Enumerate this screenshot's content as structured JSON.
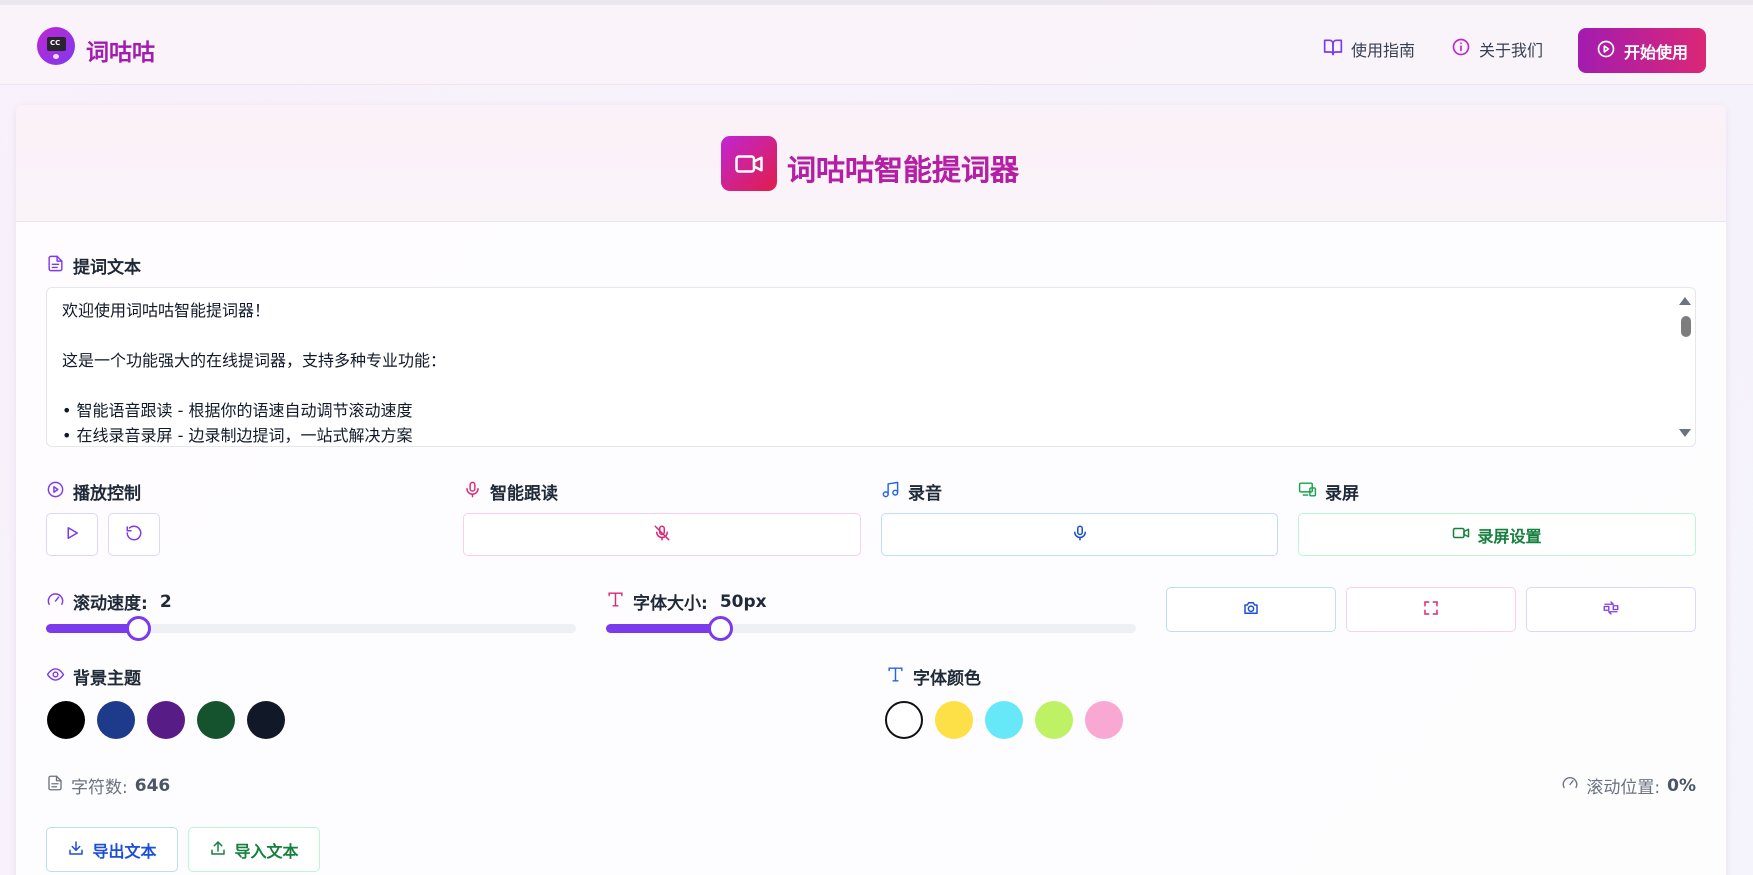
{
  "header": {
    "brand": "词咕咕",
    "nav": {
      "guide": "使用指南",
      "about": "关于我们"
    },
    "start_button": "开始使用"
  },
  "card": {
    "title": "词咕咕智能提词器"
  },
  "script_section": {
    "label": "提词文本",
    "lines": [
      "欢迎使用词咕咕智能提词器！",
      "",
      "这是一个功能强大的在线提词器，支持多种专业功能：",
      "",
      "• 智能语音跟读 - 根据你的语速自动调节滚动速度",
      "• 在线录音录屏 - 边录制边提词，一站式解决方案"
    ]
  },
  "controls": {
    "playback_label": "播放控制",
    "voice_follow_label": "智能跟读",
    "record_audio_label": "录音",
    "record_screen_label": "录屏",
    "record_settings_button": "录屏设置"
  },
  "sliders": {
    "speed_label": "滚动速度:",
    "speed_value": "2",
    "speed_fraction": 0.173,
    "font_label": "字体大小:",
    "font_value": "50px",
    "font_fraction": 0.215
  },
  "themes": {
    "bg_label": "背景主题",
    "bg_colors": [
      "#000000",
      "#1e3a8a",
      "#581c87",
      "#14532d",
      "#111827"
    ],
    "font_label": "字体颜色",
    "font_colors": [
      "#ffffff",
      "#fde047",
      "#67e8f9",
      "#bef264",
      "#f9a8d4"
    ]
  },
  "stats": {
    "chars_label": "字符数:",
    "chars_value": "646",
    "scroll_label": "滚动位置:",
    "scroll_value": "0%"
  },
  "actions": {
    "export": "导出文本",
    "import": "导入文本"
  },
  "colors": {
    "accent_purple": "#7c3aed",
    "accent_magenta": "#c026d3",
    "accent_pink": "#db2777",
    "accent_blue": "#1d4ed8",
    "accent_green": "#15803d"
  }
}
